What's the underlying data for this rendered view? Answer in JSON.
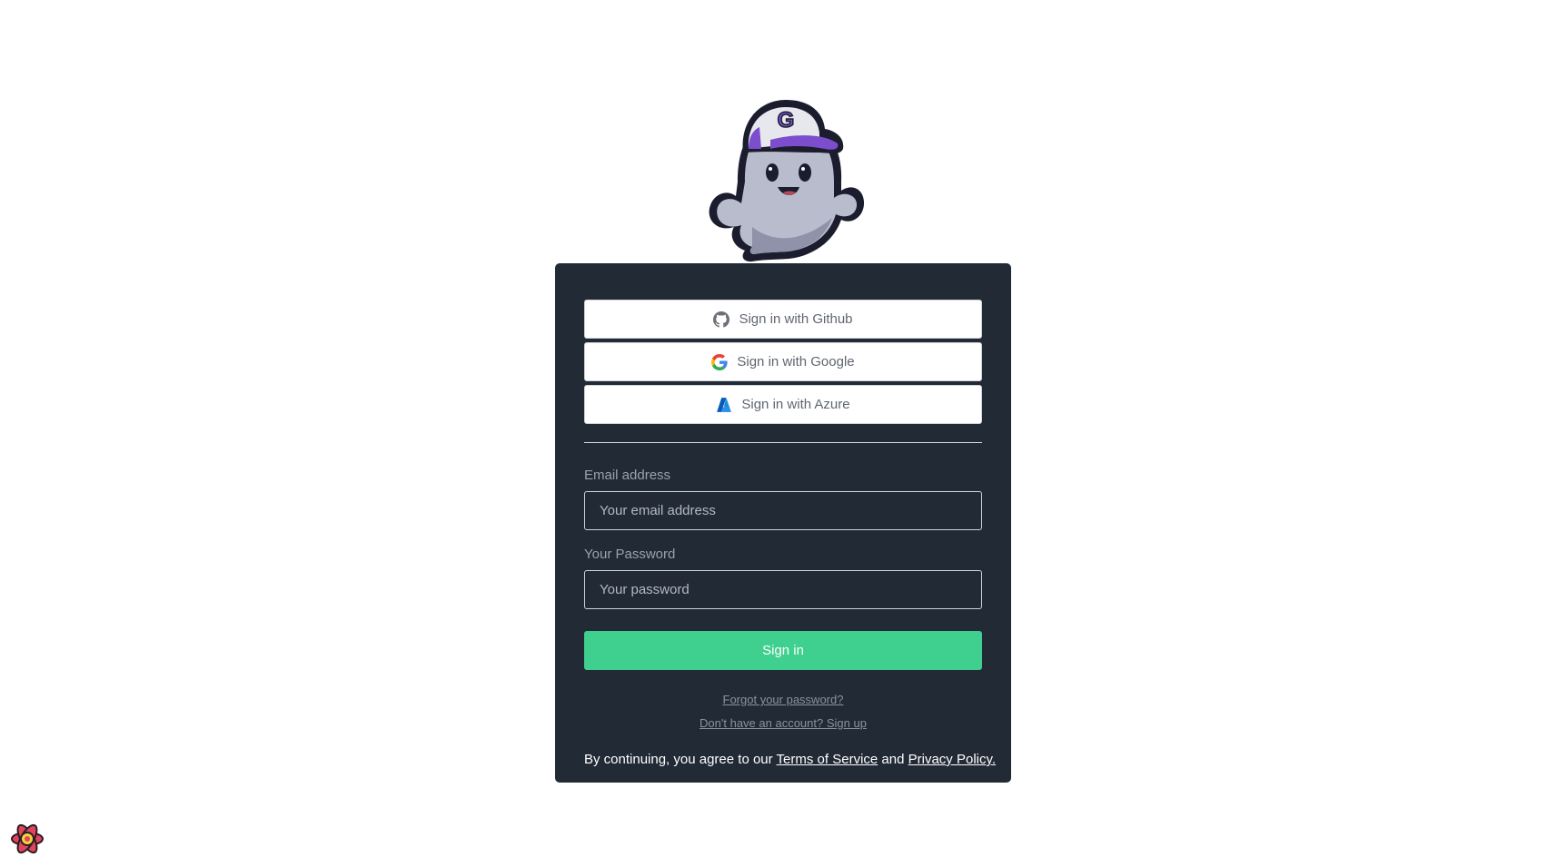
{
  "auth": {
    "providers": [
      {
        "label": "Sign in with Github",
        "icon": "github-icon"
      },
      {
        "label": "Sign in with Google",
        "icon": "google-icon"
      },
      {
        "label": "Sign in with Azure",
        "icon": "azure-icon"
      }
    ],
    "email": {
      "label": "Email address",
      "placeholder": "Your email address",
      "value": ""
    },
    "password": {
      "label": "Your Password",
      "placeholder": "Your password",
      "value": ""
    },
    "submit_label": "Sign in",
    "forgot_label": "Forgot your password?",
    "signup_label": "Don't have an account? Sign up",
    "terms": {
      "prefix": "By continuing, you agree to our",
      "tos_label": "Terms of Service",
      "and": "and",
      "privacy_label": "Privacy Policy."
    }
  },
  "colors": {
    "card_bg": "#222a36",
    "primary": "#3fcf8e",
    "mascot_cap": "#7c4dcc"
  },
  "icons": {
    "mascot": "ghost-mascot-logo",
    "devtools": "react-devtools-icon"
  }
}
